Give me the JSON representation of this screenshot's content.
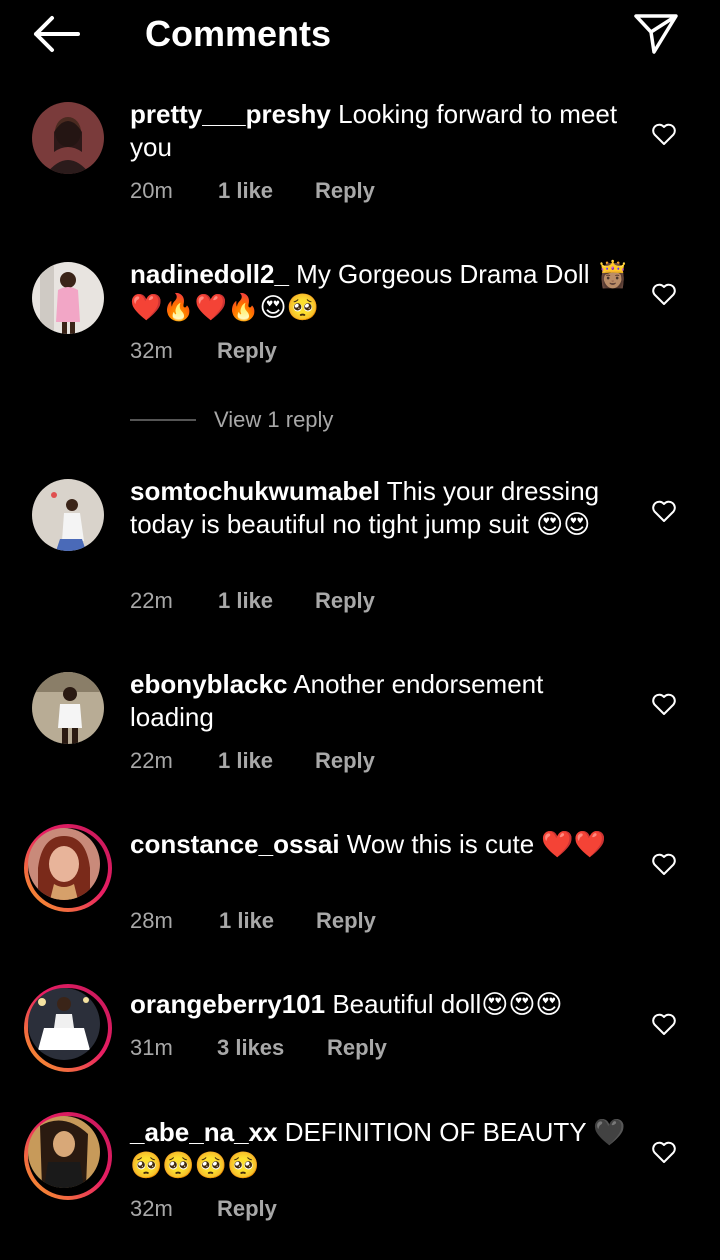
{
  "header": {
    "title": "Comments",
    "back_icon": "arrow-left-icon",
    "send_icon": "send-icon"
  },
  "comments": [
    {
      "username": "pretty___preshy",
      "text": "Looking forward to meet you",
      "time": "20m",
      "likes": "1 like",
      "reply": "Reply"
    },
    {
      "username": "nadinedoll2_",
      "text": "My Gorgeous Drama Doll 👸🏽❤️🔥❤️🔥😍🥺",
      "time": "32m",
      "likes": "",
      "reply": "Reply",
      "view_replies": "View 1 reply"
    },
    {
      "username": "somtochukwumabel",
      "text": "This your dressing today is beautiful no tight jump suit 😍😍",
      "time": "22m",
      "likes": "1 like",
      "reply": "Reply"
    },
    {
      "username": "ebonyblackc",
      "text": "Another endorsement loading",
      "time": "22m",
      "likes": "1 like",
      "reply": "Reply"
    },
    {
      "username": "constance_ossai",
      "text": "Wow this is cute ❤️❤️",
      "time": "28m",
      "likes": "1 like",
      "reply": "Reply"
    },
    {
      "username": "orangeberry101",
      "text": "Beautiful doll😍😍😍",
      "time": "31m",
      "likes": "3 likes",
      "reply": "Reply"
    },
    {
      "username": "_abe_na_xx",
      "text": "DEFINITION OF BEAUTY 🖤🥺🥺🥺🥺",
      "time": "32m",
      "likes": "",
      "reply": "Reply"
    }
  ],
  "colors": {
    "background": "#000000",
    "text": "#ffffff",
    "meta": "#a8a8a8",
    "story_ring_start": "#f9a825",
    "story_ring_end": "#c2185b"
  }
}
